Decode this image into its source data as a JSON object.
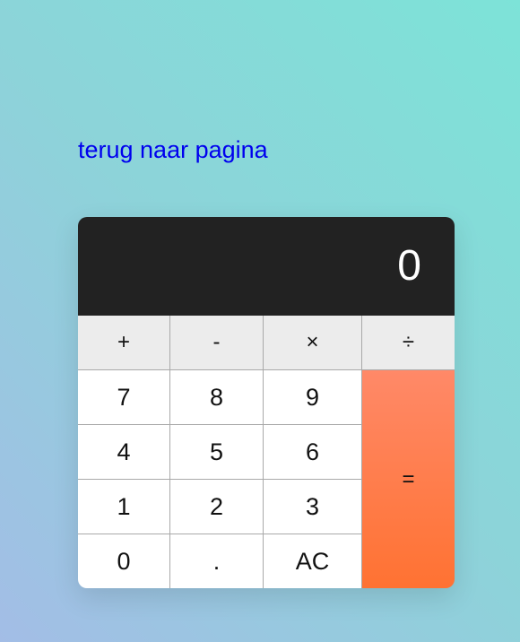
{
  "link": {
    "text": "terug naar pagina"
  },
  "display": {
    "value": "0"
  },
  "operators": [
    "+",
    "-",
    "×",
    "÷"
  ],
  "digits": {
    "row1": [
      "7",
      "8",
      "9"
    ],
    "row2": [
      "4",
      "5",
      "6"
    ],
    "row3": [
      "1",
      "2",
      "3"
    ],
    "row4": [
      "0",
      ".",
      "AC"
    ]
  },
  "equals": "="
}
